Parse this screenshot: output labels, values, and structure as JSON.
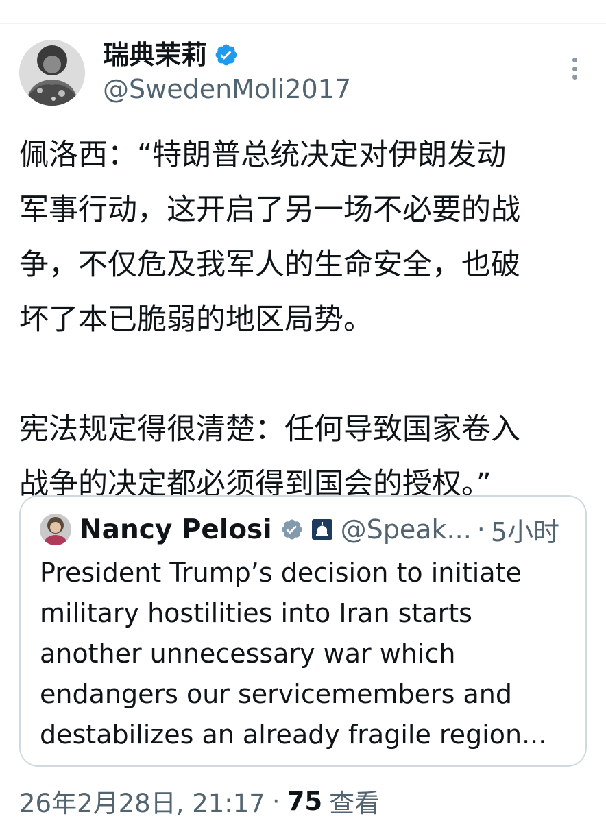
{
  "tweet": {
    "author": {
      "display_name": "瑞典茉莉",
      "handle": "@SwedenMoli2017",
      "verified": true
    },
    "text_lines": [
      "佩洛西：“特朗普总统决定对伊朗发动",
      "军事行动，这开启了另一场不必要的战",
      "争，不仅危及我军人的生命安全，也破",
      "坏了本已脆弱的地区局势。",
      "宪法规定得很清楚：任何导致国家卷入",
      "战争的决定都必须得到国会的授权。”"
    ],
    "quote": {
      "author": {
        "display_name": "Nancy Pelosi",
        "handle": "@Speak...",
        "verified": true
      },
      "separator": "·",
      "time": "5小时",
      "text_lines": [
        "President Trump’s decision to initiate",
        "military hostilities into Iran starts",
        "another unnecessary war which",
        "endangers our servicemembers and",
        "destabilizes an already fragile region..."
      ]
    },
    "meta": {
      "timestamp": "26年2月28日, 21:17",
      "separator": "·",
      "views_count": "75",
      "views_label": "查看"
    }
  },
  "colors": {
    "verified_blue": "#1d9bf0",
    "gov_grey": "#829aab",
    "text_primary": "#0f1419",
    "text_secondary": "#536471",
    "border": "#cfd9de"
  },
  "icons": {
    "more": "more-vertical-icon",
    "verified": "verified-badge-icon",
    "government": "government-badge-icon"
  }
}
